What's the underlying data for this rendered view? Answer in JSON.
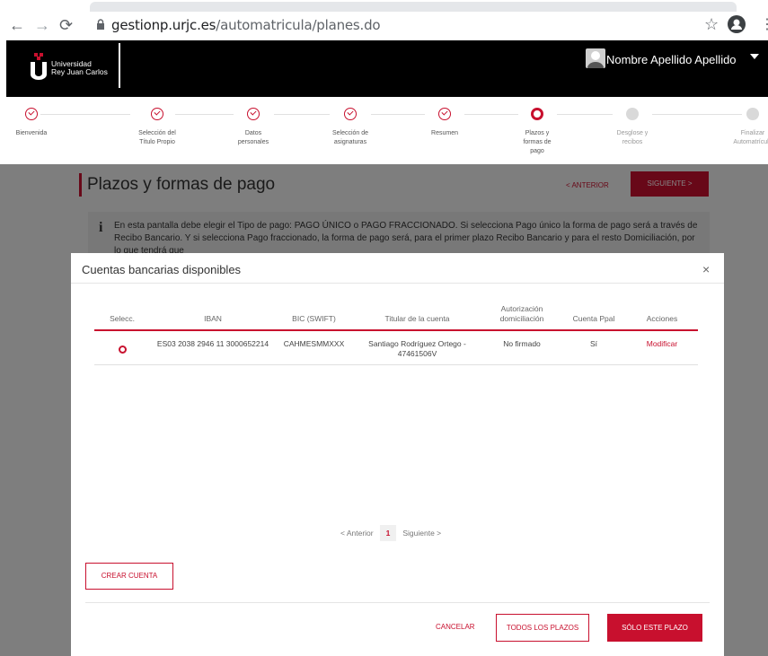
{
  "browser": {
    "url_host": "gestionp.urjc.es",
    "url_path": "/automatricula/planes.do"
  },
  "header": {
    "logo_line1": "Universidad",
    "logo_line2": "Rey Juan Carlos",
    "user_name": "Nombre Apellido Apellido"
  },
  "stepper": {
    "steps": [
      {
        "label": "Bienvenida",
        "state": "done"
      },
      {
        "label": "Selección del Título Propio",
        "state": "done"
      },
      {
        "label": "Datos personales",
        "state": "done"
      },
      {
        "label": "Selección de asignaturas",
        "state": "done"
      },
      {
        "label": "Resumen",
        "state": "done"
      },
      {
        "label": "Plazos y formas de pago",
        "state": "current"
      },
      {
        "label": "Desglose y recibos",
        "state": "pending"
      },
      {
        "label": "Finalizar Automatrícula",
        "state": "pending"
      }
    ]
  },
  "page": {
    "title": "Plazos y formas de pago",
    "anterior": "< ANTERIOR",
    "siguiente": "SIGUIENTE >",
    "info_text": "En esta pantalla debe elegir el Tipo de pago: PAGO ÚNICO o PAGO FRACCIONADO. Si selecciona Pago único la forma de pago será a través de Recibo Bancario. Y si selecciona Pago fraccionado, la forma de pago será, para el primer plazo Recibo Bancario y para el resto Domiciliación, por lo que tendrá que"
  },
  "modal": {
    "title": "Cuentas bancarias disponibles",
    "close": "×",
    "columns": [
      "Selecc.",
      "IBAN",
      "BIC (SWIFT)",
      "Titular de la cuenta",
      "Autorización domiciliación",
      "Cuenta Ppal",
      "Acciones"
    ],
    "rows": [
      {
        "iban": "ES03 2038 2946 11 3000652214",
        "bic": "CAHMESMMXXX",
        "titular": "Santiago Rodríguez Ortego - 47461506V",
        "autorizacion": "No firmado",
        "principal": "Sí",
        "accion": "Modificar"
      }
    ],
    "pagination": {
      "prev": "< Anterior",
      "current": "1",
      "next": "Siguiente >"
    },
    "crear_cuenta": "CREAR CUENTA",
    "cancelar": "CANCELAR",
    "todos_plazos": "TODOS LOS PLAZOS",
    "solo_plazo": "SÓLO ESTE PLAZO"
  },
  "colors": {
    "accent": "#c8102e",
    "header_bg": "#000000"
  }
}
